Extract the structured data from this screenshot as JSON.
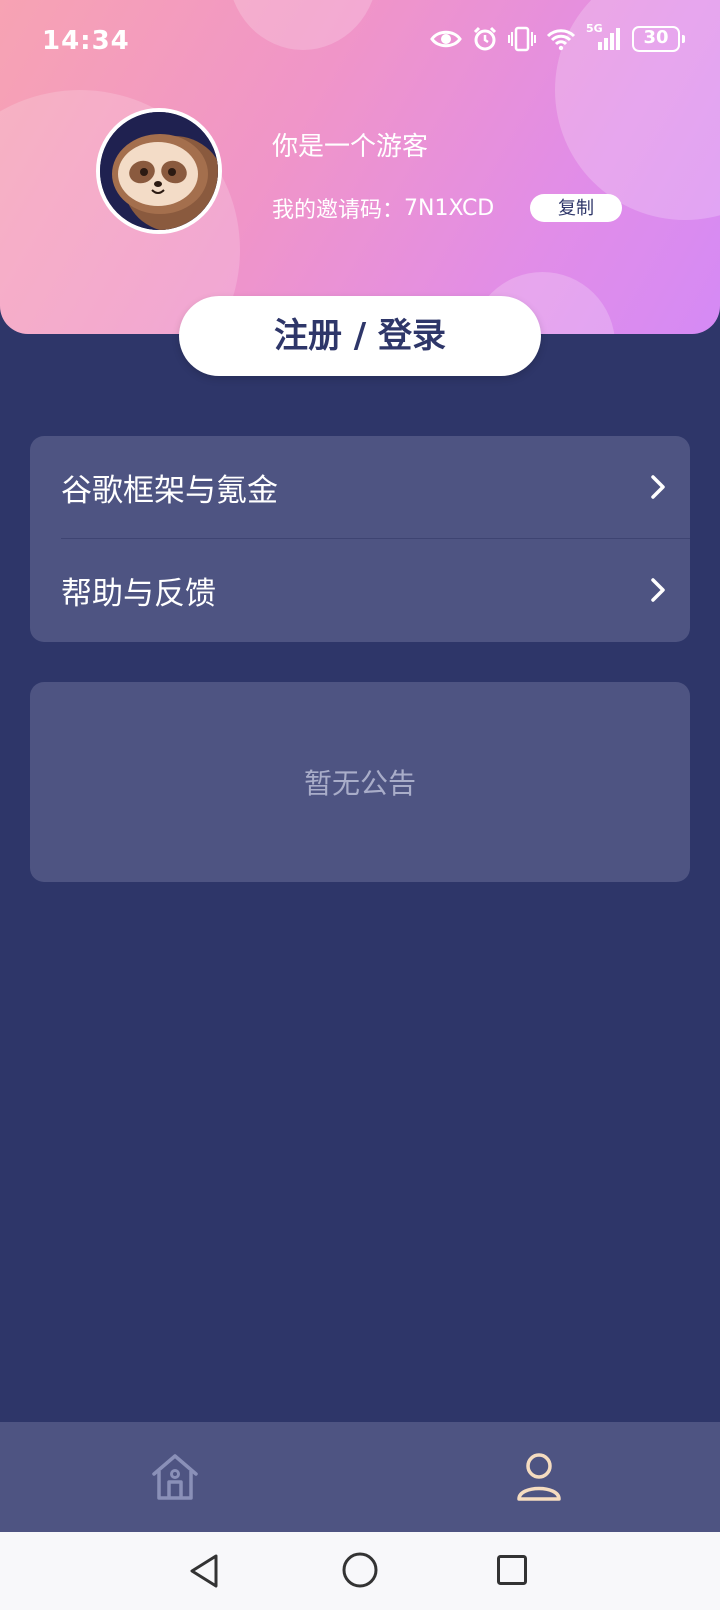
{
  "status_bar": {
    "time": "14:34",
    "network": "5G",
    "battery": "30",
    "icons": [
      "eye-icon",
      "alarm-icon",
      "vibrate-icon",
      "wifi-icon",
      "signal-icon",
      "battery-icon"
    ]
  },
  "profile": {
    "name": "你是一个游客",
    "invite_label": "我的邀请码：",
    "invite_code": "7N1XCD",
    "copy_label": "复制",
    "avatar_icon": "sloth-avatar"
  },
  "login_button": "注册 / 登录",
  "menu": {
    "items": [
      {
        "label": "谷歌框架与氪金",
        "icon": "chevron-right-icon"
      },
      {
        "label": "帮助与反馈",
        "icon": "chevron-right-icon"
      }
    ]
  },
  "notice": {
    "text": "暂无公告"
  },
  "tabbar": {
    "tabs": [
      {
        "icon": "home-icon",
        "active": false
      },
      {
        "icon": "user-icon",
        "active": true
      }
    ],
    "active_color": "#f5dcc0",
    "inactive_color": "#8a90b8"
  },
  "colors": {
    "background": "#2e3669",
    "card": "#4e5482",
    "gradient_start": "#f7a3b3",
    "gradient_end": "#d58af5"
  }
}
